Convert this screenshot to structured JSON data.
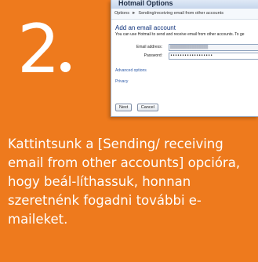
{
  "step": {
    "number": "2"
  },
  "caption": {
    "text": "Kattintsunk a [Sending/ receiving email from other accounts] opcióra, hogy beál-líthassuk, honnan szeretnénk fogadni további e-maileket."
  },
  "window": {
    "title": "Hotmail Options",
    "breadcrumb_root": "Options",
    "breadcrumb_sep": "►",
    "breadcrumb_current": "Sending/receiving email from other accounts",
    "heading": "Add an email account",
    "description": "You can use Hotmail to send and receive email from other accounts. To ge",
    "email_label": "Email address:",
    "email_value": "████████████████",
    "password_label": "Password:",
    "password_value": "••••••••••••••••••",
    "advanced_link": "Advanced options",
    "privacy_link": "Privacy",
    "next_button": "Next",
    "cancel_button": "Cancel"
  },
  "colors": {
    "background": "#ee7a1d",
    "text": "#ffffff",
    "heading": "#0b2f7a",
    "link": "#2d5aa8"
  }
}
